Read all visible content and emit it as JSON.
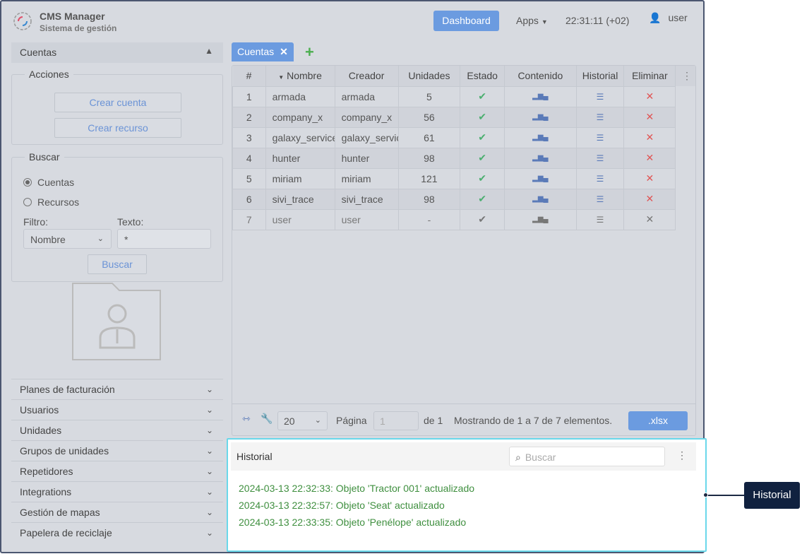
{
  "header": {
    "title": "CMS Manager",
    "subtitle": "Sistema de gestión",
    "dashboard": "Dashboard",
    "apps": "Apps",
    "time": "22:31:11 (+02)",
    "user": "user"
  },
  "sidebar": {
    "section": "Cuentas",
    "acciones": {
      "legend": "Acciones",
      "crear_cuenta": "Crear cuenta",
      "crear_recurso": "Crear recurso"
    },
    "buscar": {
      "legend": "Buscar",
      "radio_cuentas": "Cuentas",
      "radio_recursos": "Recursos",
      "filtro_label": "Filtro:",
      "filtro_value": "Nombre",
      "texto_label": "Texto:",
      "texto_value": "*",
      "button": "Buscar"
    },
    "items": [
      {
        "label": "Planes de facturación"
      },
      {
        "label": "Usuarios"
      },
      {
        "label": "Unidades"
      },
      {
        "label": "Grupos de unidades"
      },
      {
        "label": "Repetidores"
      },
      {
        "label": "Integrations"
      },
      {
        "label": "Gestión de mapas"
      },
      {
        "label": "Papelera de reciclaje"
      }
    ]
  },
  "tabs": [
    {
      "label": "Cuentas"
    }
  ],
  "table": {
    "columns": [
      "#",
      "Nombre",
      "Creador",
      "Unidades",
      "Estado",
      "Contenido",
      "Historial",
      "Eliminar"
    ],
    "rows": [
      {
        "n": "1",
        "nombre": "armada",
        "creador": "armada",
        "unidades": "5",
        "active": true
      },
      {
        "n": "2",
        "nombre": "company_x",
        "creador": "company_x",
        "unidades": "56",
        "active": true
      },
      {
        "n": "3",
        "nombre": "galaxy_service",
        "creador": "galaxy_service",
        "unidades": "61",
        "active": true
      },
      {
        "n": "4",
        "nombre": "hunter",
        "creador": "hunter",
        "unidades": "98",
        "active": true
      },
      {
        "n": "5",
        "nombre": "miriam",
        "creador": "miriam",
        "unidades": "121",
        "active": true
      },
      {
        "n": "6",
        "nombre": "sivi_trace",
        "creador": "sivi_trace",
        "unidades": "98",
        "active": true
      },
      {
        "n": "7",
        "nombre": "user",
        "creador": "user",
        "unidades": "-",
        "active": false
      }
    ],
    "footer": {
      "page_size": "20",
      "pagina": "Página",
      "page": "1",
      "de": "de 1",
      "mostrando": "Mostrando de 1 a 7 de 7 elementos.",
      "export": ".xlsx"
    }
  },
  "historial": {
    "title": "Historial",
    "search_placeholder": "Buscar",
    "entries": [
      "2024-03-13 22:32:33: Objeto 'Tractor 001' actualizado",
      "2024-03-13 22:32:57: Objeto 'Seat' actualizado",
      "2024-03-13 22:33:35: Objeto 'Penélope' actualizado"
    ]
  },
  "callout": "Historial",
  "colors": {
    "accent": "#6b9be0",
    "ok": "#4caf70",
    "delete": "#e05555",
    "log": "#3f8f3f",
    "highlight": "#6ad8ea"
  }
}
